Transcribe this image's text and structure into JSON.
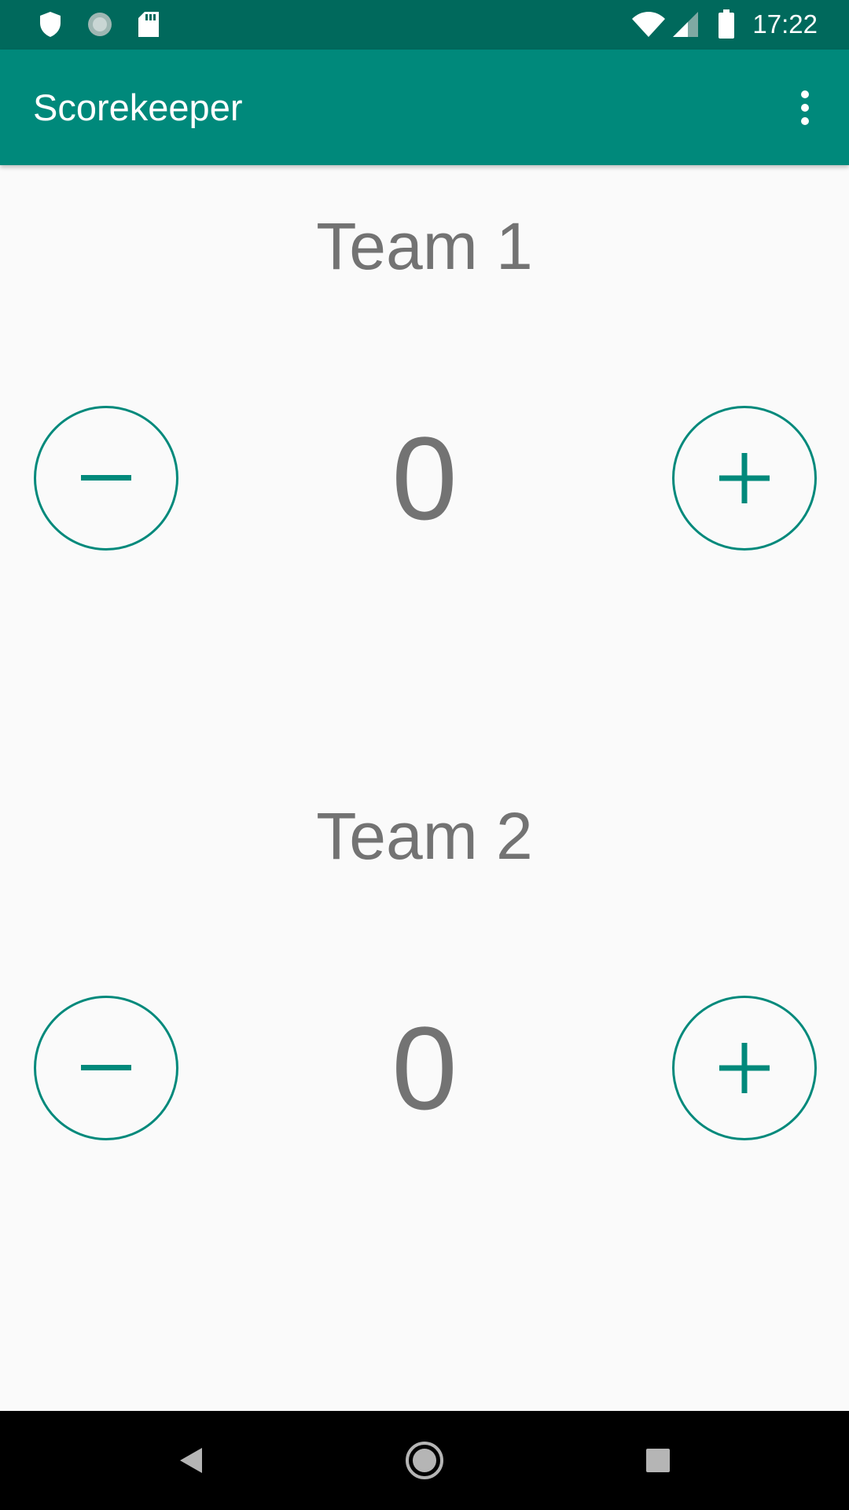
{
  "status_bar": {
    "time": "17:22",
    "left_icons": [
      "shield-icon",
      "circle-notification-icon",
      "sd-card-icon"
    ],
    "right_icons": [
      "wifi-icon",
      "cell-signal-icon",
      "battery-icon"
    ]
  },
  "app_bar": {
    "title": "Scorekeeper",
    "overflow_icon": "more-vert-icon"
  },
  "teams": [
    {
      "name": "Team 1",
      "score": "0",
      "decrement_icon": "minus-icon",
      "increment_icon": "plus-icon"
    },
    {
      "name": "Team 2",
      "score": "0",
      "decrement_icon": "minus-icon",
      "increment_icon": "plus-icon"
    }
  ],
  "nav_bar": {
    "icons": [
      "back-triangle-icon",
      "home-circle-icon",
      "recents-square-icon"
    ]
  },
  "colors": {
    "primary": "#00897b",
    "primary_dark": "#00695c",
    "text_secondary": "#737373",
    "background": "#fafafa"
  }
}
